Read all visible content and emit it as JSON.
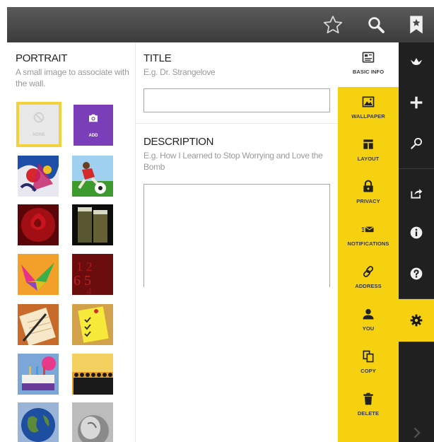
{
  "toolbar": {
    "icons": [
      "star-outline-icon",
      "search-icon",
      "bookmark-star-icon"
    ]
  },
  "portrait": {
    "title": "PORTRAIT",
    "hint": "A small image to associate with the wall.",
    "none_label": "NONE",
    "add_label": "ADD",
    "thumbnails": [
      "abstract-art-image",
      "soccer-player-image",
      "red-rose-image",
      "champagne-glasses-image",
      "origami-crane-image",
      "red-numbers-image",
      "notepad-pencil-image",
      "checklist-note-image",
      "birthday-cake-image",
      "crowd-silhouette-image",
      "globe-image",
      "pregnant-belly-image"
    ]
  },
  "form": {
    "title_label": "TITLE",
    "title_placeholder": "E.g. Dr. Strangelove",
    "title_value": "",
    "description_label": "DESCRIPTION",
    "description_placeholder": "E.g. How I Learned to Stop Worrying and Love the Bomb",
    "description_value": ""
  },
  "settings_nav": {
    "items": [
      {
        "label": "BASIC INFO",
        "icon": "basic-info-icon",
        "selected": false
      },
      {
        "label": "WALLPAPER",
        "icon": "wallpaper-icon",
        "selected": false
      },
      {
        "label": "LAYOUT",
        "icon": "layout-icon",
        "selected": false
      },
      {
        "label": "PRIVACY",
        "icon": "lock-icon",
        "selected": false
      },
      {
        "label": "NOTIFICATIONS",
        "icon": "notifications-icon",
        "selected": false
      },
      {
        "label": "ADDRESS",
        "icon": "link-icon",
        "selected": false
      },
      {
        "label": "YOU",
        "icon": "person-icon",
        "selected": false
      },
      {
        "label": "COPY",
        "icon": "copy-icon",
        "selected": false
      },
      {
        "label": "DELETE",
        "icon": "trash-icon",
        "selected": false
      }
    ]
  },
  "right_rail": {
    "icons": [
      "padlet-logo-icon",
      "plus-icon",
      "search-icon",
      "share-icon",
      "info-icon",
      "help-icon",
      "settings-gear-icon",
      "chevron-right-icon"
    ],
    "active": "settings-gear-icon"
  },
  "colors": {
    "accent_yellow": "#f6d10f",
    "add_purple": "#7a3fb8",
    "rail_dark": "#202020",
    "topbar_gray": "#4a4a4a",
    "hint_gray": "#9a9a9a"
  }
}
